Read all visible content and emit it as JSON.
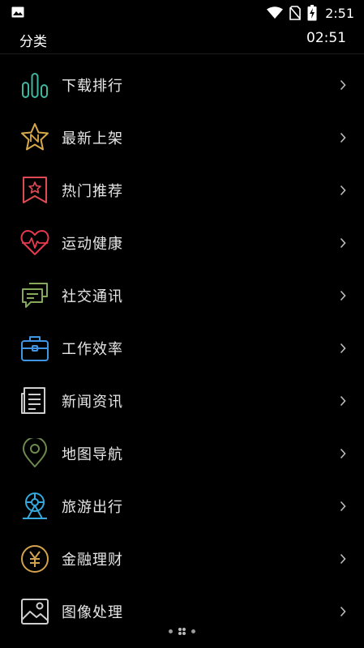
{
  "status_bar": {
    "time": "2:51",
    "left_icon": "image-icon",
    "right_icons": [
      "wifi-icon",
      "no-sim-icon",
      "battery-charging-icon"
    ]
  },
  "header": {
    "title": "分类",
    "time": "02:51"
  },
  "categories": [
    {
      "label": "下载排行",
      "icon": "bar-chart-icon",
      "color": "#3fb7a0"
    },
    {
      "label": "最新上架",
      "icon": "star-badge-icon",
      "color": "#d8a94a"
    },
    {
      "label": "热门推荐",
      "icon": "bookmark-star-icon",
      "color": "#e04a55"
    },
    {
      "label": "运动健康",
      "icon": "heartbeat-icon",
      "color": "#e8394f"
    },
    {
      "label": "社交通讯",
      "icon": "chat-bubbles-icon",
      "color": "#86a85b"
    },
    {
      "label": "工作效率",
      "icon": "briefcase-icon",
      "color": "#3e96e4"
    },
    {
      "label": "新闻资讯",
      "icon": "newspaper-icon",
      "color": "#cfcfcf"
    },
    {
      "label": "地图导航",
      "icon": "map-pin-icon",
      "color": "#6f8a4e"
    },
    {
      "label": "旅游出行",
      "icon": "ferris-wheel-icon",
      "color": "#35a8dd"
    },
    {
      "label": "金融理财",
      "icon": "yuan-coin-icon",
      "color": "#d2a24c"
    },
    {
      "label": "图像处理",
      "icon": "picture-icon",
      "color": "#cfcfcf"
    }
  ],
  "pager": {
    "count": 3,
    "active": 1
  }
}
